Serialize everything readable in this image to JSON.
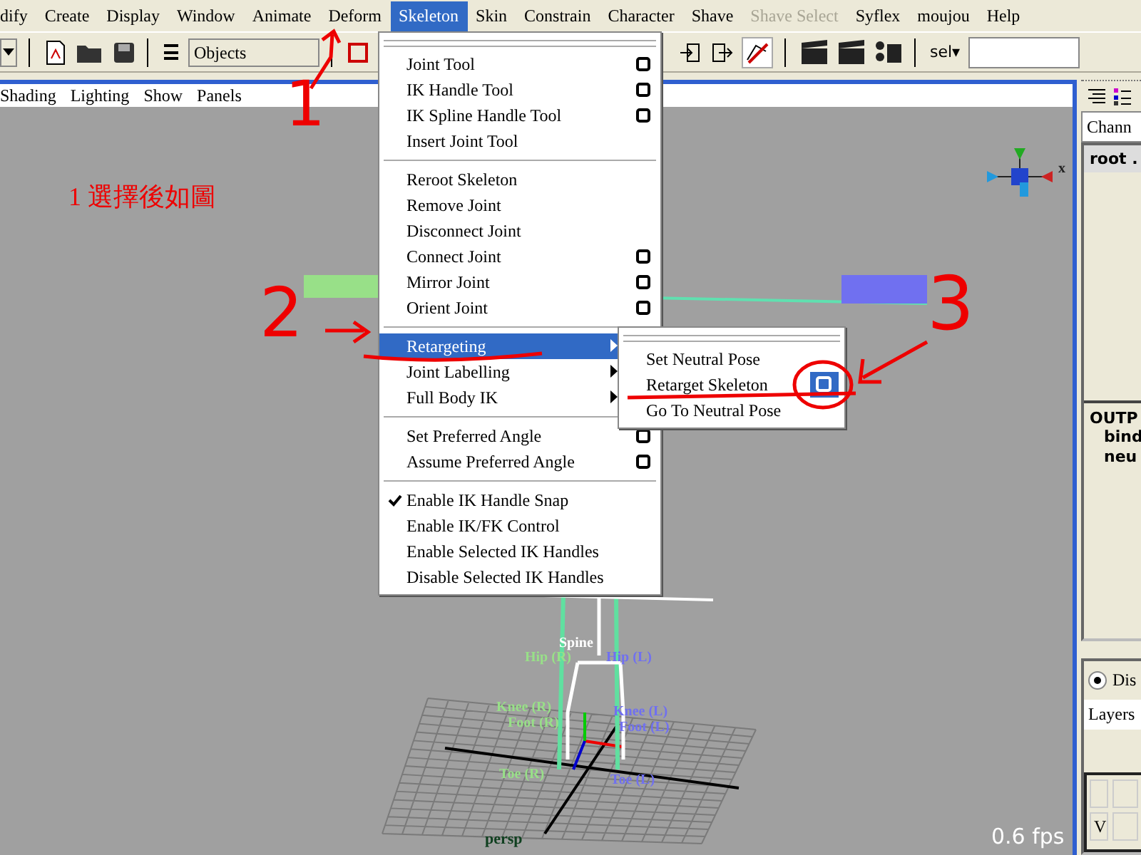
{
  "menu_bar": [
    {
      "label": "dify",
      "selected": false,
      "disabled": false
    },
    {
      "label": "Create",
      "selected": false,
      "disabled": false
    },
    {
      "label": "Display",
      "selected": false,
      "disabled": false
    },
    {
      "label": "Window",
      "selected": false,
      "disabled": false
    },
    {
      "label": "Animate",
      "selected": false,
      "disabled": false
    },
    {
      "label": "Deform",
      "selected": false,
      "disabled": false
    },
    {
      "label": "Skeleton",
      "selected": true,
      "disabled": false
    },
    {
      "label": "Skin",
      "selected": false,
      "disabled": false
    },
    {
      "label": "Constrain",
      "selected": false,
      "disabled": false
    },
    {
      "label": "Character",
      "selected": false,
      "disabled": false
    },
    {
      "label": "Shave",
      "selected": false,
      "disabled": false
    },
    {
      "label": "Shave Select",
      "selected": false,
      "disabled": true
    },
    {
      "label": "Syflex",
      "selected": false,
      "disabled": false
    },
    {
      "label": "moujou",
      "selected": false,
      "disabled": false
    },
    {
      "label": "Help",
      "selected": false,
      "disabled": false
    }
  ],
  "toolbar": {
    "mode_field": "Objects",
    "selection_menu": "sel▾"
  },
  "panel_menu": [
    "Shading",
    "Lighting",
    "Show",
    "Panels"
  ],
  "skeleton_menu": {
    "groups": [
      [
        {
          "label": "Joint Tool",
          "kind": "option",
          "checked": false,
          "selected": false
        },
        {
          "label": "IK Handle Tool",
          "kind": "option",
          "checked": false,
          "selected": false
        },
        {
          "label": "IK Spline Handle Tool",
          "kind": "option",
          "checked": false,
          "selected": false
        },
        {
          "label": "Insert Joint Tool",
          "kind": "plain",
          "checked": false,
          "selected": false
        }
      ],
      [
        {
          "label": "Reroot Skeleton",
          "kind": "plain",
          "checked": false,
          "selected": false
        },
        {
          "label": "Remove Joint",
          "kind": "plain",
          "checked": false,
          "selected": false
        },
        {
          "label": "Disconnect Joint",
          "kind": "plain",
          "checked": false,
          "selected": false
        },
        {
          "label": "Connect Joint",
          "kind": "option",
          "checked": false,
          "selected": false
        },
        {
          "label": "Mirror Joint",
          "kind": "option",
          "checked": false,
          "selected": false
        },
        {
          "label": "Orient Joint",
          "kind": "option",
          "checked": false,
          "selected": false
        }
      ],
      [
        {
          "label": "Retargeting",
          "kind": "submenu",
          "checked": false,
          "selected": true
        },
        {
          "label": "Joint Labelling",
          "kind": "submenu",
          "checked": false,
          "selected": false
        },
        {
          "label": "Full Body IK",
          "kind": "submenu",
          "checked": false,
          "selected": false
        }
      ],
      [
        {
          "label": "Set Preferred Angle",
          "kind": "option",
          "checked": false,
          "selected": false
        },
        {
          "label": "Assume Preferred Angle",
          "kind": "option",
          "checked": false,
          "selected": false
        }
      ],
      [
        {
          "label": "Enable IK Handle Snap",
          "kind": "plain",
          "checked": true,
          "selected": false
        },
        {
          "label": "Enable IK/FK Control",
          "kind": "plain",
          "checked": false,
          "selected": false
        },
        {
          "label": "Enable Selected IK Handles",
          "kind": "plain",
          "checked": false,
          "selected": false
        },
        {
          "label": "Disable Selected IK Handles",
          "kind": "plain",
          "checked": false,
          "selected": false
        }
      ]
    ]
  },
  "retargeting_submenu": [
    {
      "label": "Set Neutral Pose",
      "kind": "plain",
      "selected": false
    },
    {
      "label": "Retarget Skeleton",
      "kind": "option",
      "selected": true
    },
    {
      "label": "Go To Neutral Pose",
      "kind": "plain",
      "selected": false
    }
  ],
  "viewport": {
    "camera": "persp",
    "fps": "0.6 fps",
    "axis_label": "x",
    "joint_labels": [
      {
        "label": "Spine",
        "color": "#ffffff"
      },
      {
        "label": "Hip (R)",
        "color": "#98e088"
      },
      {
        "label": "Hip (L)",
        "color": "#7070f0"
      },
      {
        "label": "Knee (R)",
        "color": "#98e088"
      },
      {
        "label": "Knee (L)",
        "color": "#7070f0"
      },
      {
        "label": "Foot (R)",
        "color": "#98e088"
      },
      {
        "label": "Foot (L)",
        "color": "#7070f0"
      },
      {
        "label": "Toe (R)",
        "color": "#98e088"
      },
      {
        "label": "Toe (L)",
        "color": "#7070f0"
      }
    ]
  },
  "annotations": {
    "note": "1 選擇後如圖",
    "marks": [
      "1",
      "2",
      "3"
    ]
  },
  "channel_box": {
    "tab": "Chann",
    "node": "root .",
    "outputs_heading": "OUTP",
    "outputs": [
      "bind",
      "neu"
    ]
  },
  "layer_editor": {
    "display_option": {
      "label": "Dis",
      "selected": true
    },
    "layers_label": "Layers",
    "visibility": "V"
  }
}
